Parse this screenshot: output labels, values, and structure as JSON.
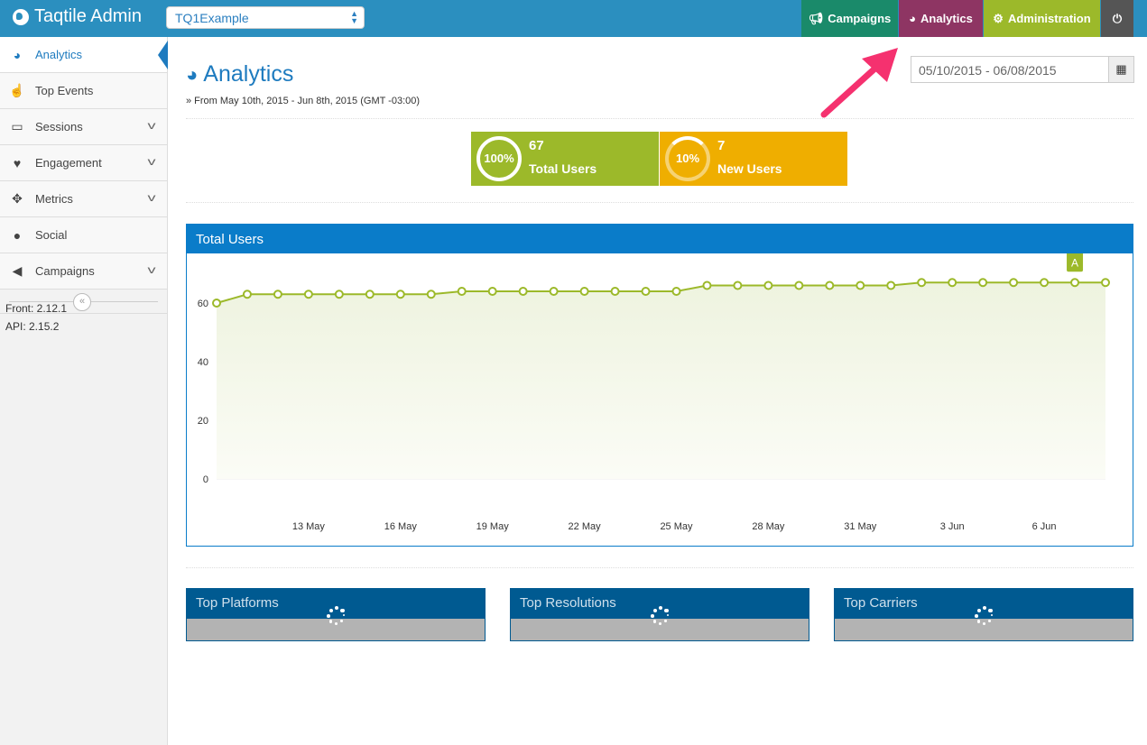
{
  "header": {
    "brand": "Taqtile Admin",
    "app_select": "TQ1Example",
    "nav": [
      {
        "label": "Campaigns",
        "color": "#1a8a6a"
      },
      {
        "label": "Analytics",
        "color": "#8e3563"
      },
      {
        "label": "Administration",
        "color": "#9cb92a"
      }
    ]
  },
  "sidebar": {
    "items": [
      {
        "label": "Analytics",
        "icon": "dashboard-icon"
      },
      {
        "label": "Top Events",
        "icon": "hand-pointer-icon"
      },
      {
        "label": "Sessions",
        "icon": "desktop-icon"
      },
      {
        "label": "Engagement",
        "icon": "heart-icon"
      },
      {
        "label": "Metrics",
        "icon": "arrows-icon"
      },
      {
        "label": "Social",
        "icon": "comment-icon"
      },
      {
        "label": "Campaigns",
        "icon": "bullhorn-icon"
      }
    ],
    "front_version": "Front: 2.12.1",
    "api_version": "API: 2.15.2"
  },
  "page": {
    "title": "Analytics",
    "subtitle": "» From May 10th, 2015 - Jun 8th, 2015 (GMT -03:00)",
    "date_range": "05/10/2015 - 06/08/2015"
  },
  "stats": [
    {
      "percent": "100%",
      "value": "67",
      "label": "Total Users",
      "color": "#9cb92a",
      "fraction": 1.0
    },
    {
      "percent": "10%",
      "value": "7",
      "label": "New Users",
      "color": "#efae00",
      "fraction": 0.1
    }
  ],
  "chart_data": {
    "type": "area",
    "title": "Total Users",
    "ylim": [
      0,
      80
    ],
    "yticks": [
      0,
      20,
      40,
      60,
      80
    ],
    "xtick_labels": [
      "13 May",
      "16 May",
      "19 May",
      "22 May",
      "25 May",
      "28 May",
      "31 May",
      "3 Jun",
      "6 Jun"
    ],
    "x": [
      "May 10",
      "May 11",
      "May 12",
      "May 13",
      "May 14",
      "May 15",
      "May 16",
      "May 17",
      "May 18",
      "May 19",
      "May 20",
      "May 21",
      "May 22",
      "May 23",
      "May 24",
      "May 25",
      "May 26",
      "May 27",
      "May 28",
      "May 29",
      "May 30",
      "May 31",
      "Jun 1",
      "Jun 2",
      "Jun 3",
      "Jun 4",
      "Jun 5",
      "Jun 6",
      "Jun 7",
      "Jun 8"
    ],
    "values": [
      60,
      63,
      63,
      63,
      63,
      63,
      63,
      63,
      64,
      64,
      64,
      64,
      64,
      64,
      64,
      64,
      66,
      66,
      66,
      66,
      66,
      66,
      66,
      67,
      67,
      67,
      67,
      67,
      67,
      67
    ],
    "annotation": "A",
    "color": "#9cb92a"
  },
  "bottom_panels": [
    "Top Platforms",
    "Top Resolutions",
    "Top Carriers"
  ]
}
